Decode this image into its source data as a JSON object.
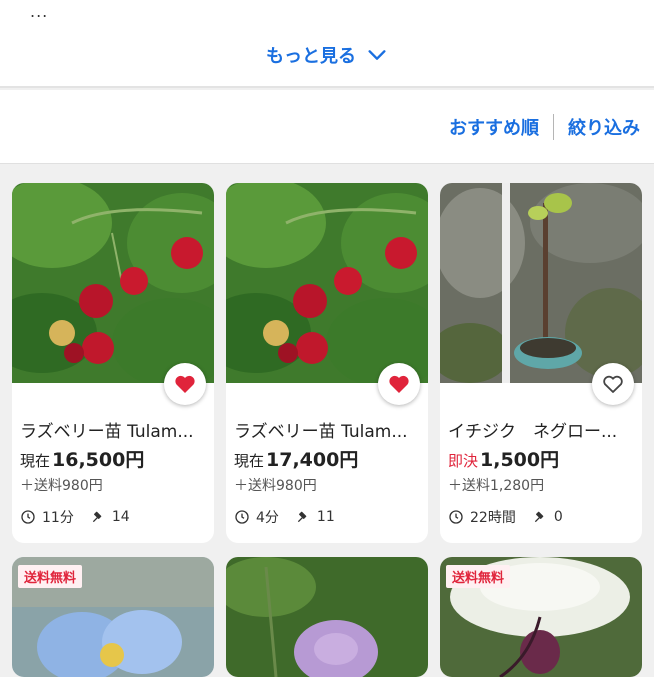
{
  "top": {
    "ellipsis": "...",
    "more_label": "もっと見る"
  },
  "sort": {
    "recommend_label": "おすすめ順",
    "filter_label": "絞り込み"
  },
  "items": [
    {
      "title": "ラズベリー苗 Tulam...",
      "price_label": "現在",
      "price": "16,500円",
      "shipping": "＋送料980円",
      "time": "11分",
      "bids": "14",
      "favorited": true
    },
    {
      "title": "ラズベリー苗 Tulam...",
      "price_label": "現在",
      "price": "17,400円",
      "shipping": "＋送料980円",
      "time": "4分",
      "bids": "11",
      "favorited": true
    },
    {
      "title": "イチジク　ネグロー...",
      "price_label": "即決",
      "price": "1,500円",
      "shipping": "＋送料1,280円",
      "time": "22時間",
      "bids": "0",
      "favorited": false
    }
  ],
  "next_row": [
    {
      "badge": "送料無料"
    },
    {
      "badge": ""
    },
    {
      "badge": "送料無料"
    }
  ],
  "colors": {
    "accent": "#1a6fe0",
    "heart": "#e0243b",
    "buyout": "#e0243b"
  }
}
